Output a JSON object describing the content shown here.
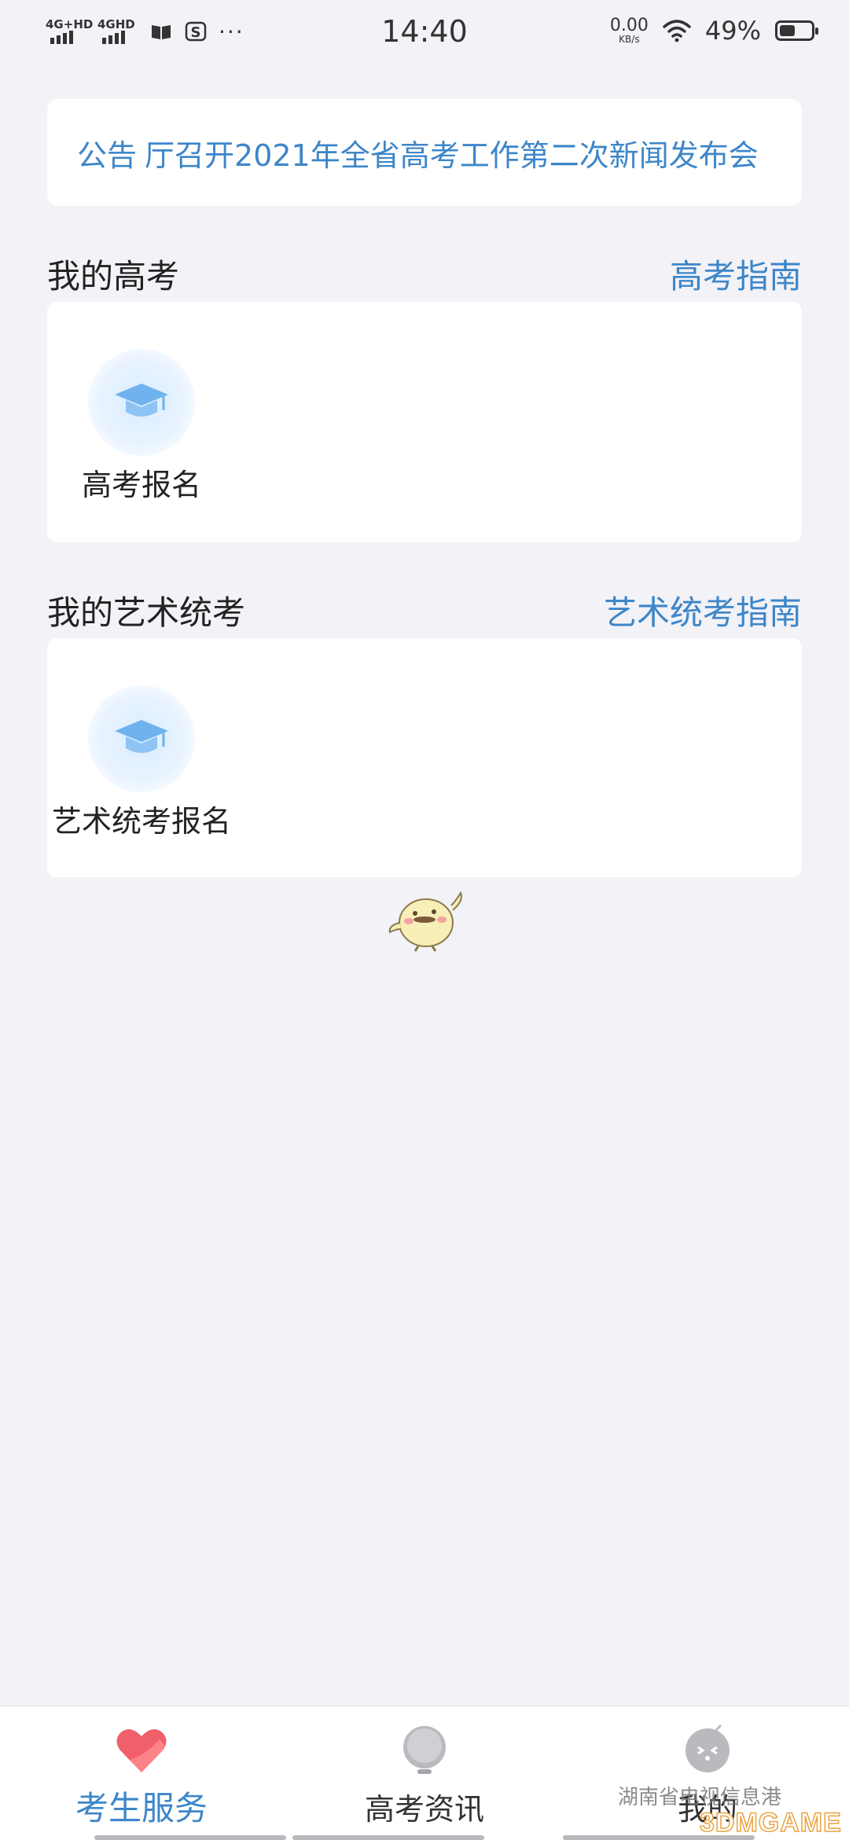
{
  "status_bar": {
    "network1": "4G+HD",
    "network2": "4GHD",
    "time": "14:40",
    "speed_value": "0.00",
    "speed_unit": "KB/s",
    "battery_percent": "49%",
    "battery_level": 0.49
  },
  "notice": {
    "label": "公告",
    "text": "厅召开2021年全省高考工作第二次新闻发布会"
  },
  "section_gaokao": {
    "title": "我的高考",
    "link": "高考指南",
    "tiles": [
      {
        "label": "高考报名",
        "icon": "graduation-cap-icon"
      }
    ]
  },
  "section_art": {
    "title": "我的艺术统考",
    "link": "艺术统考指南",
    "tiles": [
      {
        "label": "艺术统考报名",
        "icon": "graduation-cap-icon"
      }
    ]
  },
  "bottom_nav": {
    "items": [
      {
        "label": "考生服务",
        "icon": "heart-icon",
        "active": true
      },
      {
        "label": "高考资讯",
        "icon": "bulb-icon",
        "active": false
      },
      {
        "label": "我的",
        "icon": "face-icon",
        "active": false
      }
    ]
  },
  "watermark": {
    "text": "湖南省电视信息港",
    "logo": "3DMGAME"
  },
  "colors": {
    "accent": "#3d86c9",
    "background": "#f2f2f7",
    "active_heart": "#f0606a"
  }
}
